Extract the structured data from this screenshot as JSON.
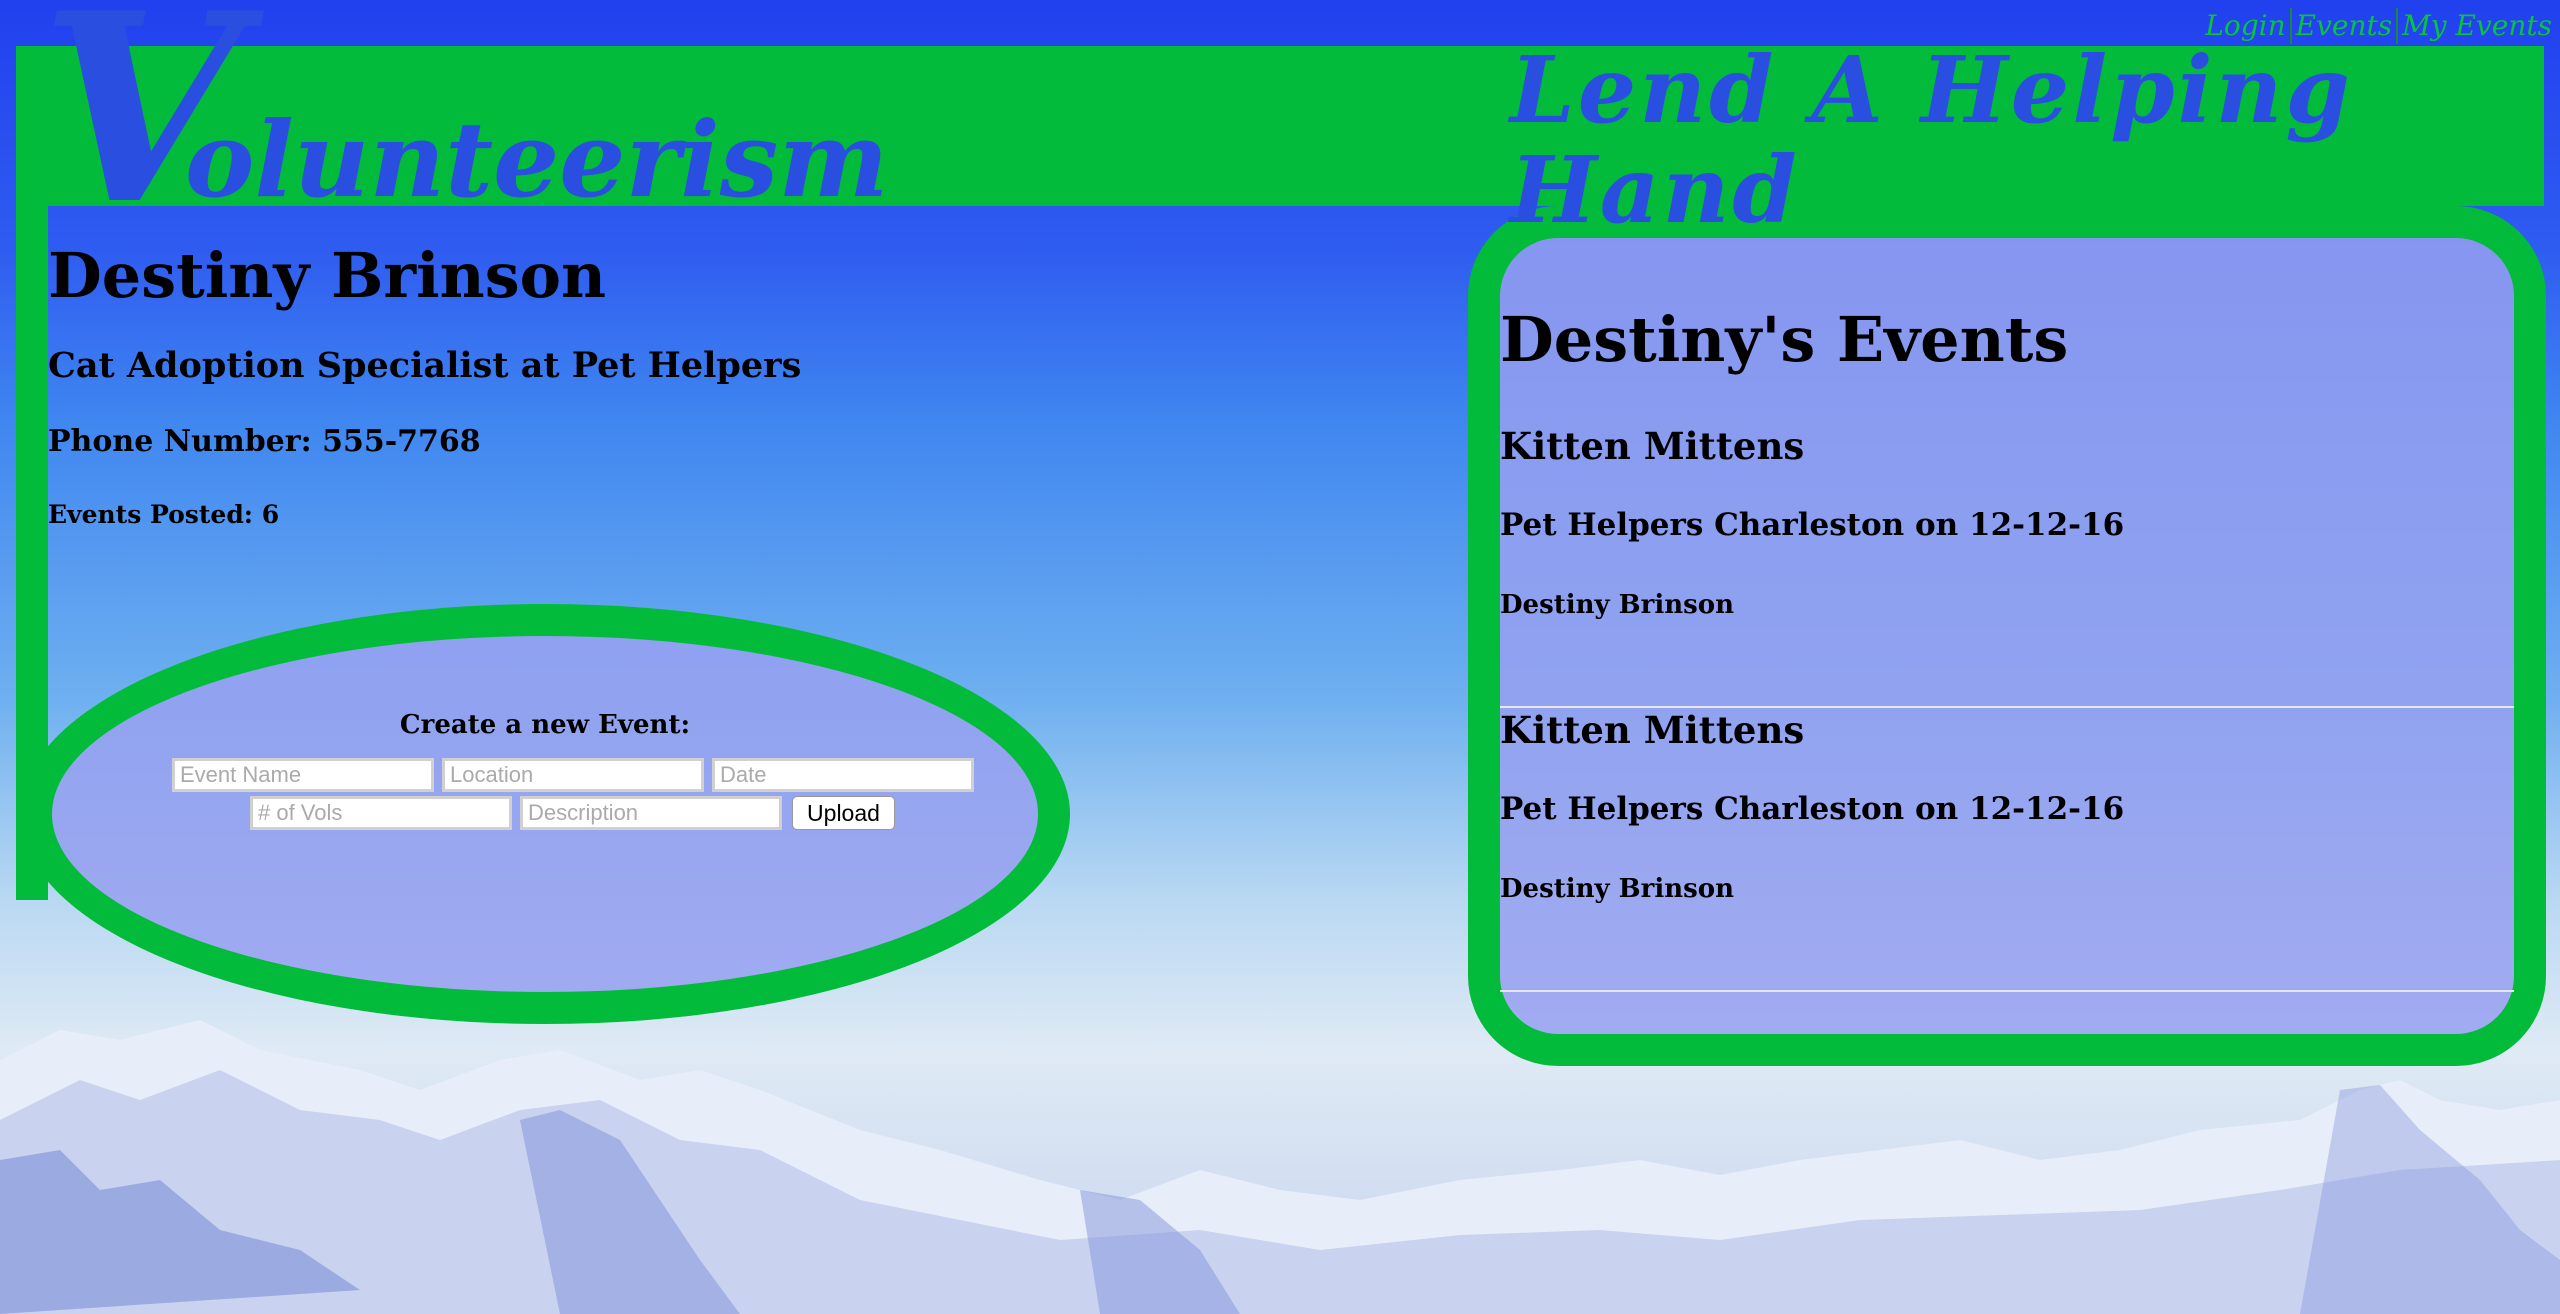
{
  "nav": {
    "items": [
      "Login",
      "Events",
      "My Events"
    ]
  },
  "header": {
    "brand_initial": "V",
    "brand_rest": "olunteerism",
    "tagline": "Lend A Helping Hand"
  },
  "profile": {
    "name": "Destiny Brinson",
    "title": "Cat Adoption Specialist at Pet Helpers",
    "phone": "Phone Number: 555-7768",
    "events_posted": "Events Posted: 6"
  },
  "create_form": {
    "title": "Create a new Event:",
    "event_name_placeholder": "Event Name",
    "location_placeholder": "Location",
    "date_placeholder": "Date",
    "vols_placeholder": "# of Vols",
    "description_placeholder": "Description",
    "upload_label": "Upload"
  },
  "events_panel": {
    "heading": "Destiny's Events",
    "events": [
      {
        "name": "Kitten Mittens",
        "where": "Pet Helpers Charleston on 12-12-16",
        "owner": "Destiny Brinson"
      },
      {
        "name": "Kitten Mittens",
        "where": "Pet Helpers Charleston on 12-12-16",
        "owner": "Destiny Brinson"
      }
    ]
  },
  "colors": {
    "accent_green": "#02bb3a",
    "brand_blue": "#2a4fe0",
    "panel_fill": "#969ff0"
  }
}
